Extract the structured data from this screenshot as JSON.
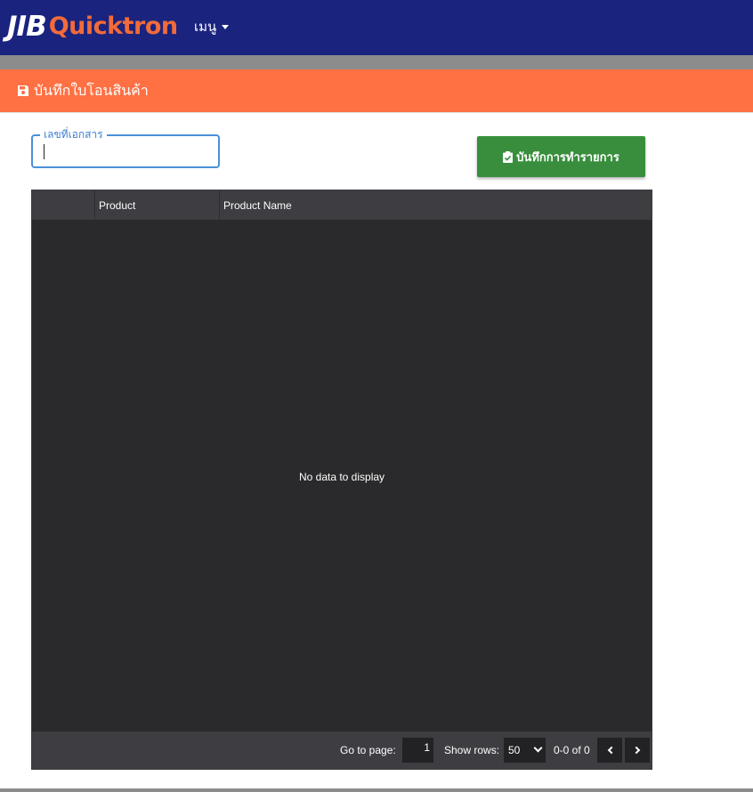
{
  "navbar": {
    "logo_jib": "JIB",
    "logo_quicktron": "Quicktron",
    "menu_label": "เมนู"
  },
  "card": {
    "title": "บันทึกใบโอนสินค้า",
    "title_icon": "save-icon",
    "doc_field": {
      "label": "เลขที่เอกสาร",
      "value": ""
    },
    "save_button": {
      "label": "บันทึกการทำรายการ",
      "icon": "clipboard-check-icon"
    }
  },
  "grid": {
    "columns": [
      "",
      "Product",
      "Product Name"
    ],
    "empty_text": "No data to display",
    "footer": {
      "goto_label": "Go to page:",
      "page_value": "1",
      "rows_label": "Show rows:",
      "rows_value": "50",
      "range_text": "0-0 of 0"
    }
  },
  "colors": {
    "navbar": "#1a237e",
    "header": "#ff7043",
    "button": "#388e3c",
    "grid_bg": "#2a2a2c"
  }
}
